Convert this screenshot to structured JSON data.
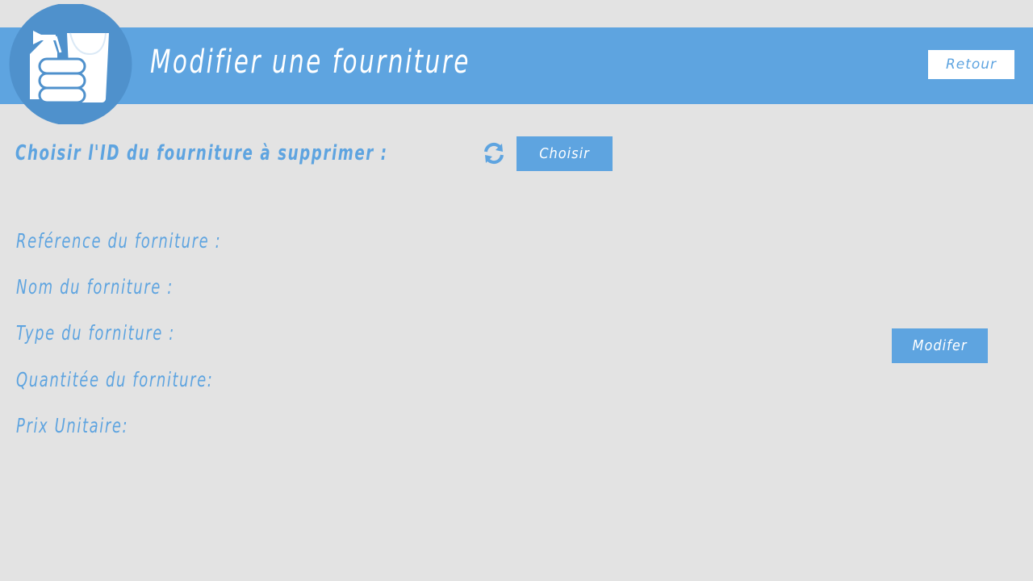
{
  "header": {
    "title": "Modifier une fourniture",
    "back_button": "Retour",
    "logo_icon": "cleaning-supplies-icon"
  },
  "selection": {
    "label": "Choisir l'ID du fourniture à supprimer :",
    "refresh_icon": "refresh-icon",
    "choose_button": "Choisir"
  },
  "form": {
    "fields": [
      {
        "label": "Reférence du forniture :"
      },
      {
        "label": "Nom du forniture :"
      },
      {
        "label": "Type du forniture :"
      },
      {
        "label": "Quantitée du forniture:"
      },
      {
        "label": "Prix Unitaire:"
      }
    ],
    "submit_button": "Modifer"
  },
  "colors": {
    "accent": "#5ea4e0",
    "background": "#e3e3e3",
    "logo_circle": "#4f91cc"
  }
}
